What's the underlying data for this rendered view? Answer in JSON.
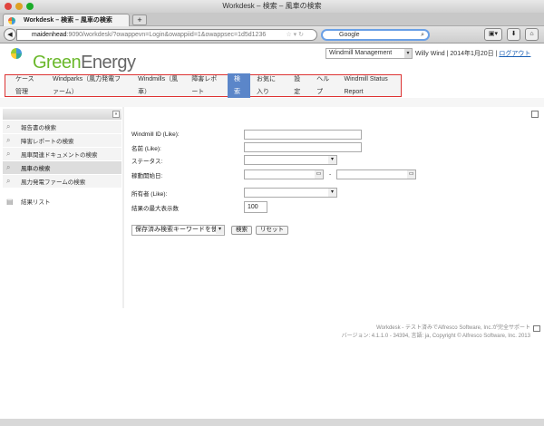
{
  "window": {
    "title": "Workdesk – 検索 – 風車の検索"
  },
  "browser": {
    "tab_title": "Workdesk – 検索 – 風車の検索",
    "new_tab": "+",
    "url_host": "maidenhead",
    "url_rest": ":9090/workdesk/?owappevn=Login&owappiid=1&owappsec=1d5d1236",
    "search_placeholder": "Google"
  },
  "header": {
    "logo_green": "Green",
    "logo_gray": "Energy",
    "workspace": "Windmill Management",
    "user": "Willy Wind",
    "date": "2014年1月20日",
    "logout": "ログアウト",
    "sep": "|"
  },
  "menu": [
    "ケース管理",
    "Windparks（風力発電ファーム）",
    "Windmills（風車）",
    "障害レポート",
    "検索",
    "お気に入り",
    "設定",
    "ヘルプ",
    "Windmill Status Report"
  ],
  "menu_active_index": 4,
  "sidebar": {
    "items": [
      "報告書の検索",
      "障害レポートの検索",
      "風車関連ドキュメントの検索",
      "風車の検索",
      "風力発電ファームの検索"
    ],
    "selected_index": 3,
    "results": "結果リスト"
  },
  "form": {
    "windmill_id_label": "Windmill ID (Like):",
    "windmill_id_value": "",
    "name_label": "名前 (Like):",
    "name_value": "",
    "status_label": "ステータス:",
    "status_value": "",
    "start_date_label": "稼動開始日:",
    "date_sep": "-",
    "owner_label": "所有者 (Like):",
    "owner_value": "",
    "max_results_label": "結果の最大表示数",
    "max_results_value": "100",
    "saved_search": "保存済み検索キーワードを使用",
    "search_button": "検索",
    "reset_button": "リセット"
  },
  "footer": {
    "line1": "Workdesk - テスト済みでAlfresco Software, Inc.が完全サポート",
    "line2": "バージョン: 4.1.1.0 - 34394, 言語: ja, Copyright © Alfresco Software, Inc. 2013"
  }
}
